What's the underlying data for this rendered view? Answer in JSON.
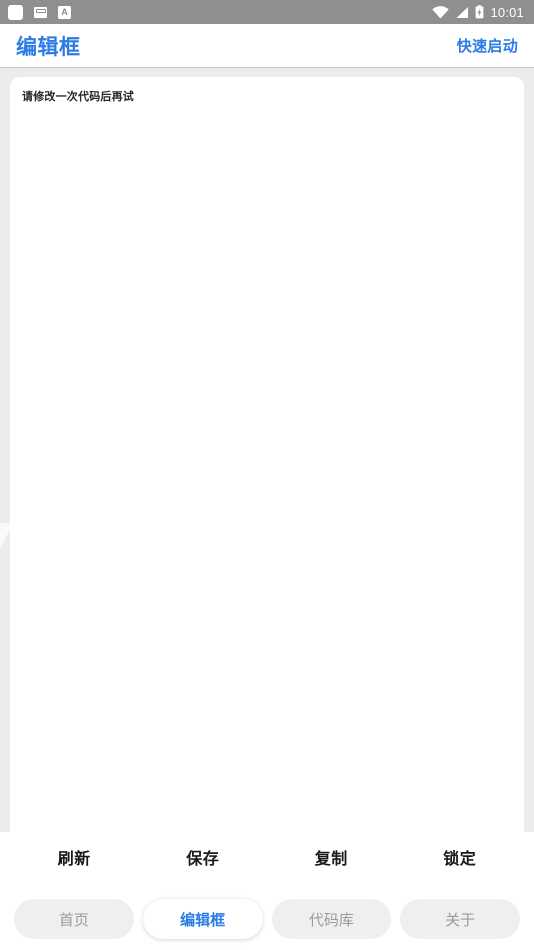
{
  "statusbar": {
    "time": "10:01",
    "left_icons": [
      {
        "name": "notification-square-icon",
        "glyph": "square"
      },
      {
        "name": "mail-icon",
        "glyph": "envelope"
      },
      {
        "name": "app-letter-a-icon",
        "glyph": "A"
      }
    ],
    "right_icons": [
      {
        "name": "wifi-icon"
      },
      {
        "name": "cellular-signal-icon"
      },
      {
        "name": "battery-charging-icon"
      }
    ]
  },
  "header": {
    "title": "编辑框",
    "action_label": "快速启动",
    "accent_color": "#2b7ce5"
  },
  "editor": {
    "content": "请修改一次代码后再试",
    "placeholder": "请修改一次代码后再试"
  },
  "actionbar": {
    "buttons": [
      {
        "label": "刷新",
        "name": "refresh-button"
      },
      {
        "label": "保存",
        "name": "save-button"
      },
      {
        "label": "复制",
        "name": "copy-button"
      },
      {
        "label": "锁定",
        "name": "lock-button"
      }
    ]
  },
  "tabbar": {
    "tabs": [
      {
        "label": "首页",
        "active": false
      },
      {
        "label": "编辑框",
        "active": true
      },
      {
        "label": "代码库",
        "active": false
      },
      {
        "label": "关于",
        "active": false
      }
    ],
    "active_color": "#2b7ce5",
    "inactive_color": "#9b9b9f"
  }
}
